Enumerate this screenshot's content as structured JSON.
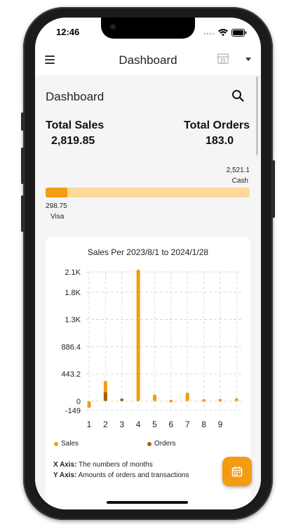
{
  "status_bar": {
    "time": "12:46"
  },
  "app_bar": {
    "title": "Dashboard",
    "menu_icon": "hamburger-menu-icon",
    "store_icon": "store-icon"
  },
  "header": {
    "title": "Dashboard",
    "search_icon": "search-icon"
  },
  "totals": {
    "sales_label": "Total Sales",
    "sales_value": "2,819.85",
    "orders_label": "Total Orders",
    "orders_value": "183.0"
  },
  "payment": {
    "cash_value": "2,521.1",
    "cash_label": "Cash",
    "visa_value": "298.75",
    "visa_label": "Visa",
    "visa_fraction": 0.106
  },
  "colors": {
    "sales": "#f39c12",
    "orders": "#a5620c",
    "cash_bar": "#fdd89a"
  },
  "chart_data": {
    "type": "bar",
    "title": "Sales Per 2023/8/1 to 2024/1/28",
    "categories": [
      "1",
      "2",
      "3",
      "4",
      "5",
      "6",
      "7",
      "8",
      "9"
    ],
    "ytick_labels": [
      "-149",
      "0",
      "443.2",
      "886.4",
      "1.3K",
      "1.8K",
      "2.1K"
    ],
    "ytick_values": [
      -149,
      0,
      443.2,
      886.4,
      1330,
      1770,
      2100
    ],
    "ylim": [
      -149,
      2100
    ],
    "series": [
      {
        "name": "Sales",
        "color": "#f39c12",
        "values": [
          -110,
          330,
          0,
          2140,
          110,
          25,
          140,
          35,
          40,
          50
        ]
      },
      {
        "name": "Orders",
        "color": "#a5620c",
        "values": [
          0,
          150,
          45,
          0,
          0,
          0,
          0,
          0,
          0,
          0
        ]
      }
    ],
    "legend": [
      {
        "label": "Sales",
        "color": "#f39c12"
      },
      {
        "label": "Orders",
        "color": "#a5620c"
      }
    ],
    "grid": true
  },
  "notes": {
    "x_label": "X Axis:",
    "x_text": "The numbers of months",
    "y_label": "Y Axis:",
    "y_text": "Amounts of orders and transactions"
  },
  "fab": {
    "icon": "calendar-icon"
  }
}
